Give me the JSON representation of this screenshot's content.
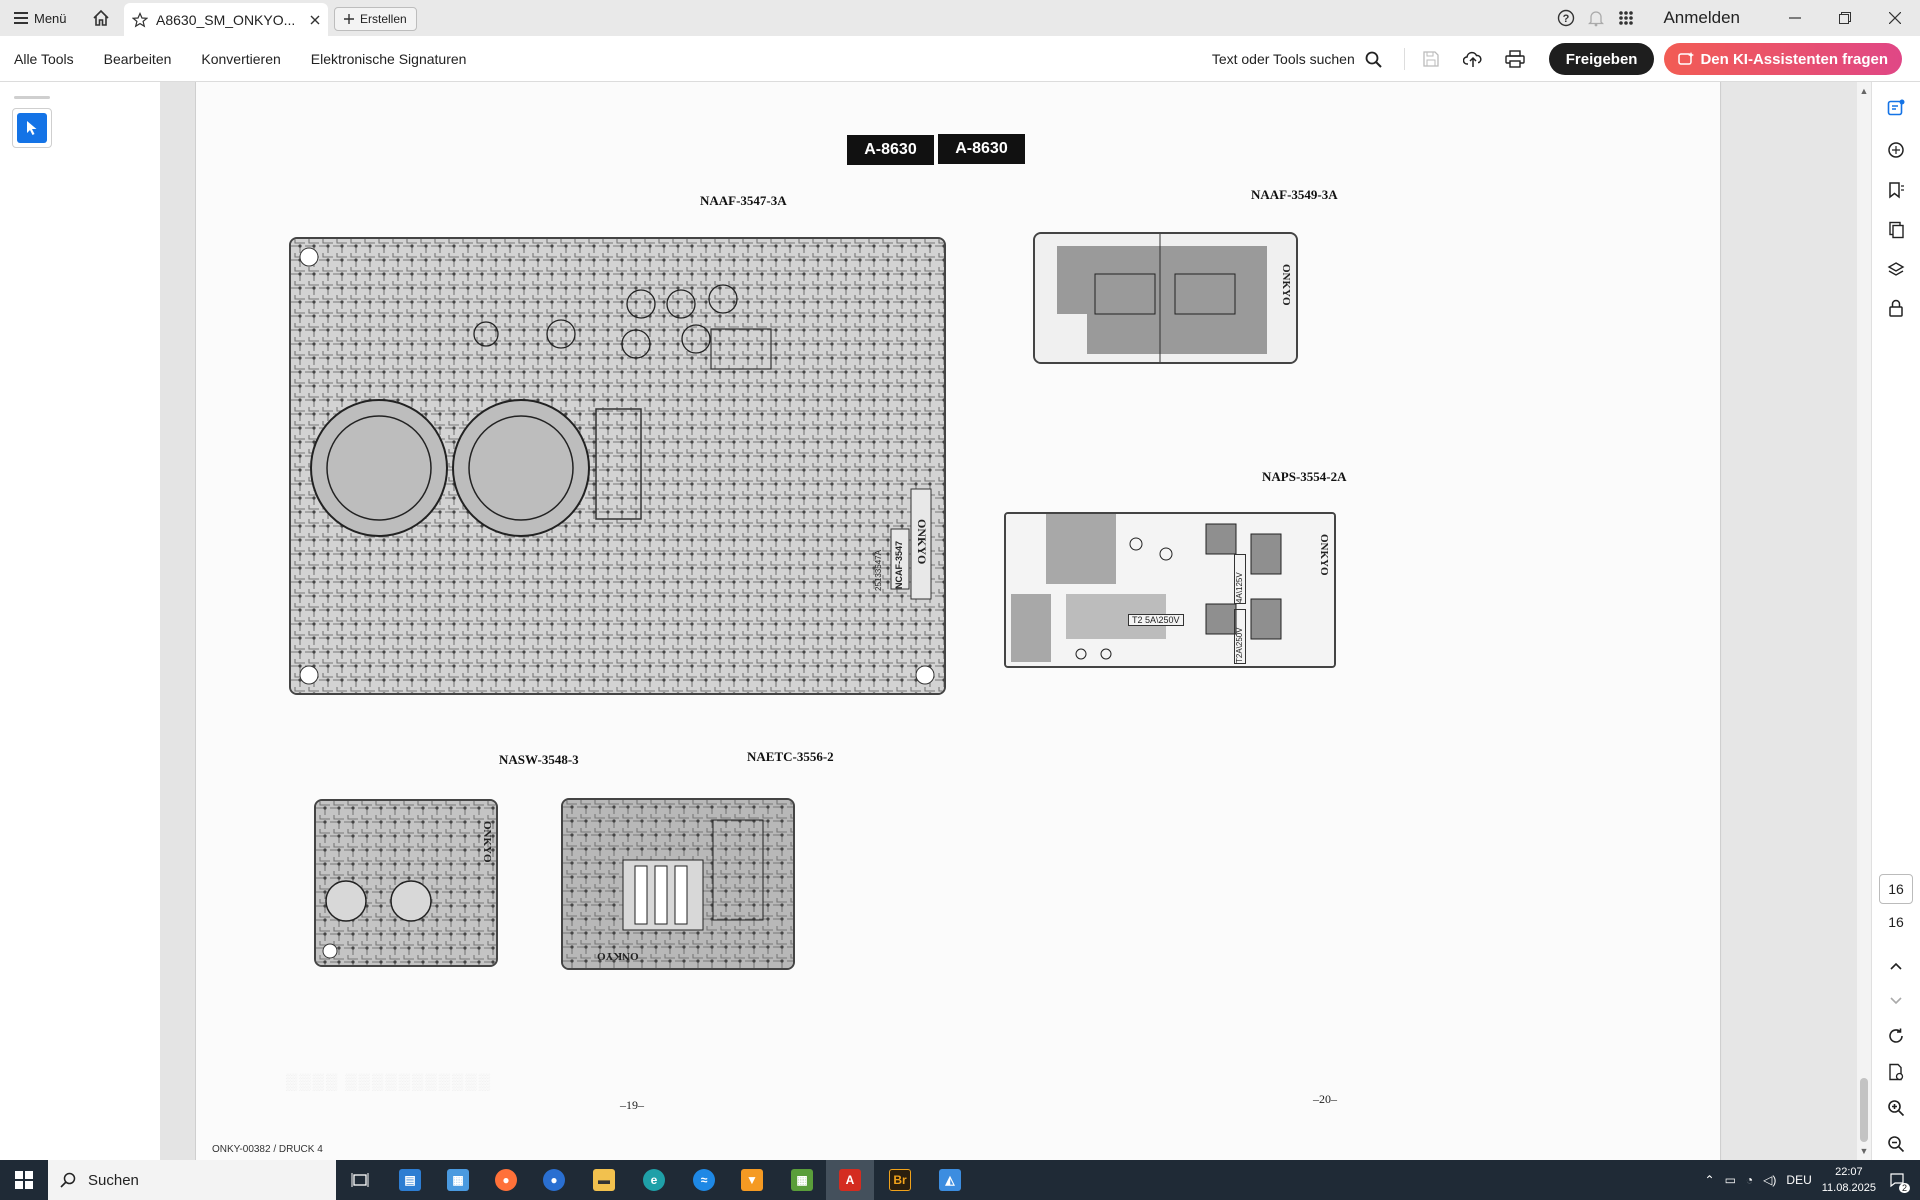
{
  "titlebar": {
    "menu_label": "Menü",
    "tab_title": "A8630_SM_ONKYO...",
    "new_tab_label": "Erstellen",
    "signin_label": "Anmelden"
  },
  "toolbar": {
    "menu_items": [
      "Alle Tools",
      "Bearbeiten",
      "Konvertieren",
      "Elektronische Signaturen"
    ],
    "search_label": "Text oder Tools suchen",
    "share_label": "Freigeben",
    "ai_label": "Den KI-Assistenten fragen"
  },
  "document": {
    "header_left": "A-8630",
    "header_right": "A-8630",
    "boards": {
      "naaf_3547": "NAAF-3547-3A",
      "naaf_3549": "NAAF-3549-3A",
      "naps_3554": "NAPS-3554-2A",
      "nasw_3548": "NASW-3548-3",
      "naetc_3556": "NAETC-3556-2"
    },
    "board_labels": {
      "ncaf": "NCAF-3547",
      "code": "25133547A",
      "brand": "ONKYO",
      "fuse_1": "T2 5A\\250V",
      "fuse_2": "4A\\125V",
      "fuse_3": "T2A\\250V"
    },
    "page_left": "–19–",
    "page_right": "–20–",
    "footer_code": "ONKY-00382 / DRUCK 4"
  },
  "navigation": {
    "current_page": "16",
    "total_pages": "16"
  },
  "taskbar": {
    "search_label": "Suchen",
    "language": "DEU",
    "time": "22:07",
    "date": "11.08.2025",
    "notification_count": "2"
  }
}
